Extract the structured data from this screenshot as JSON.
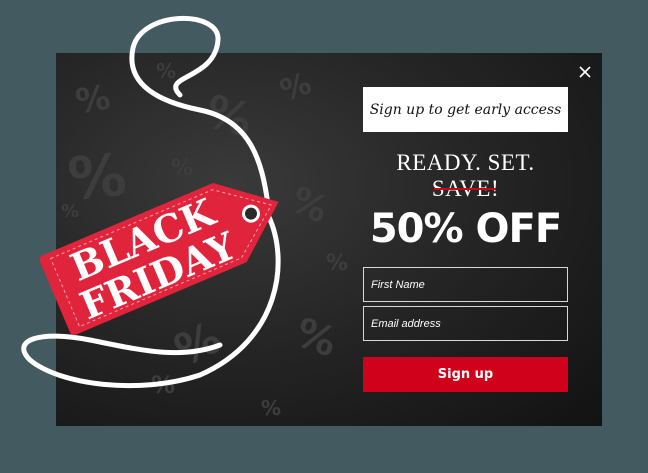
{
  "popup": {
    "tag_line_1": "BLACK",
    "tag_line_2": "FRIDAY",
    "early_access_label": "Sign up to get early access",
    "headline": "READY. SET. SAVE!",
    "offer": "50% OFF",
    "first_name_placeholder": "First Name",
    "email_placeholder": "Email address",
    "signup_label": "Sign up",
    "percent_glyph": "%"
  },
  "colors": {
    "backdrop": "#435a61",
    "popup_dark": "#1a1a1a",
    "accent_red": "#d0021b",
    "tag_red": "#e0243c",
    "text_light": "#ffffff"
  }
}
